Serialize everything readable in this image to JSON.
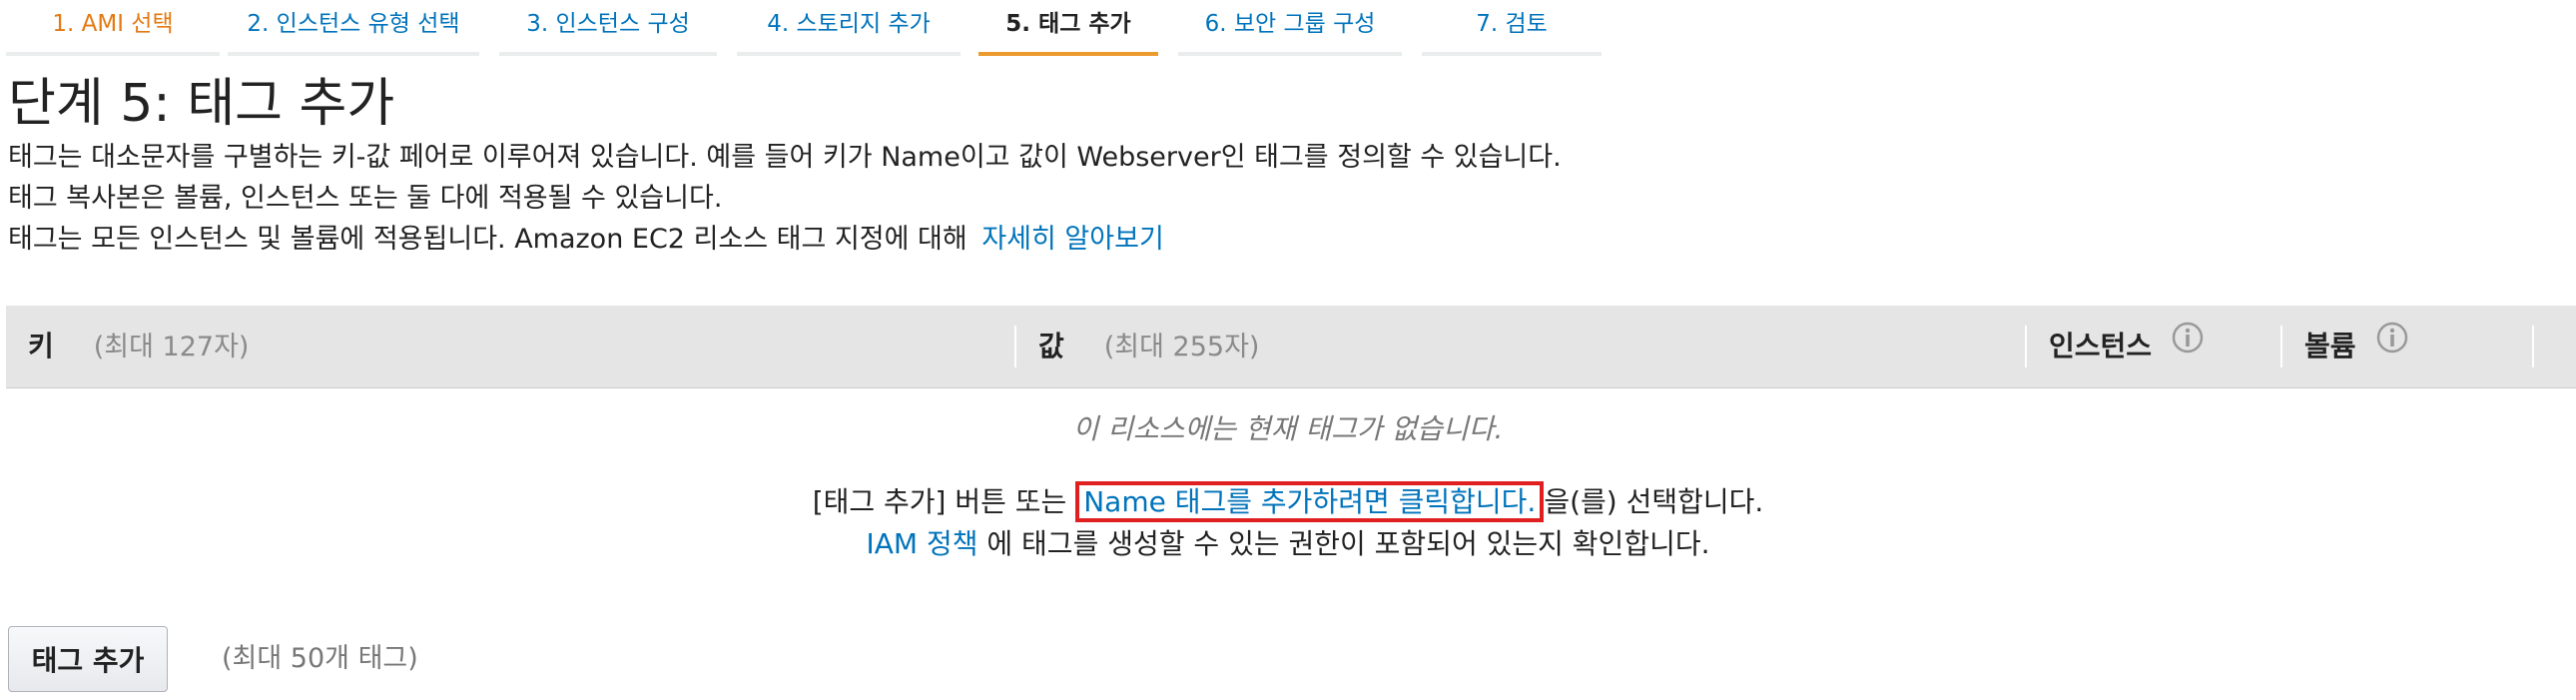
{
  "wizard_steps": [
    {
      "label": "1. AMI 선택",
      "state": "done"
    },
    {
      "label": "2. 인스턴스 유형 선택",
      "state": "pending"
    },
    {
      "label": "3. 인스턴스 구성",
      "state": "pending"
    },
    {
      "label": "4. 스토리지 추가",
      "state": "pending"
    },
    {
      "label": "5. 태그 추가",
      "state": "active"
    },
    {
      "label": "6. 보안 그룹 구성",
      "state": "pending"
    },
    {
      "label": "7. 검토",
      "state": "pending"
    }
  ],
  "page": {
    "title": "단계 5: 태그 추가",
    "desc1": "태그는 대소문자를 구별하는 키-값 페어로 이루어져 있습니다. 예를 들어 키가 Name이고 값이 Webserver인 태그를 정의할 수 있습니다.",
    "desc2": "태그 복사본은 볼륨, 인스턴스 또는 둘 다에 적용될 수 있습니다.",
    "desc3": "태그는 모든 인스턴스 및 볼륨에 적용됩니다. Amazon EC2 리소스 태그 지정에 대해",
    "learn_more": "자세히 알아보기"
  },
  "table": {
    "key_label": "키",
    "key_hint": "(최대 127자)",
    "value_label": "값",
    "value_hint": "(최대 255자)",
    "instances_label": "인스턴스",
    "volumes_label": "볼륨",
    "empty_message": "이 리소스에는 현재 태그가 없습니다.",
    "line1_prefix": "[태그 추가] 버튼 또는",
    "line1_link": "Name 태그를 추가하려면 클릭합니다.",
    "line1_suffix": "을(를) 선택합니다.",
    "line2_link": "IAM 정책",
    "line2_suffix": "에 태그를 생성할 수 있는 권한이 포함되어 있는지 확인합니다."
  },
  "actions": {
    "add_tag": "태그 추가",
    "max_tags": "(최대 50개 태그)"
  },
  "colors": {
    "link": "#0073bb",
    "done_step": "#e47911",
    "active_underline": "#eb9a2e",
    "highlight_box": "#e02020",
    "header_bg": "#e5e5e5"
  },
  "icons": {
    "info": "info-circle-icon"
  }
}
